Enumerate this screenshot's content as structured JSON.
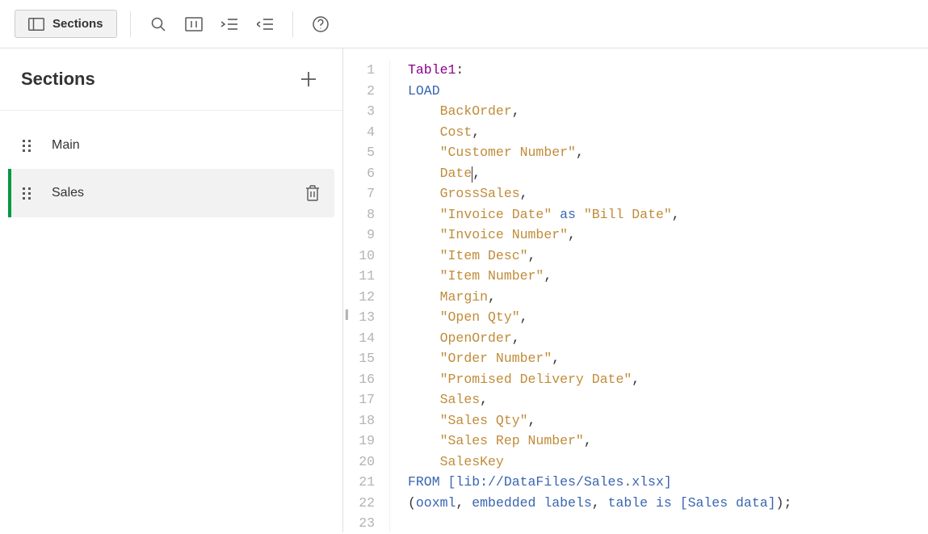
{
  "toolbar": {
    "sections_label": "Sections"
  },
  "sidebar": {
    "title": "Sections",
    "items": [
      {
        "label": "Main",
        "active": false,
        "deletable": false
      },
      {
        "label": "Sales",
        "active": true,
        "deletable": true
      }
    ]
  },
  "editor": {
    "lines": [
      {
        "n": 1,
        "tokens": [
          {
            "t": "Table1",
            "c": "label"
          },
          {
            "t": ":",
            "c": "punct"
          }
        ]
      },
      {
        "n": 2,
        "tokens": [
          {
            "t": "LOAD",
            "c": "kw"
          }
        ]
      },
      {
        "n": 3,
        "tokens": [
          {
            "t": "    ",
            "c": "ws"
          },
          {
            "t": "BackOrder",
            "c": "field"
          },
          {
            "t": ",",
            "c": "punct"
          }
        ]
      },
      {
        "n": 4,
        "tokens": [
          {
            "t": "    ",
            "c": "ws"
          },
          {
            "t": "Cost",
            "c": "field"
          },
          {
            "t": ",",
            "c": "punct"
          }
        ]
      },
      {
        "n": 5,
        "tokens": [
          {
            "t": "    ",
            "c": "ws"
          },
          {
            "t": "\"Customer Number\"",
            "c": "field"
          },
          {
            "t": ",",
            "c": "punct"
          }
        ]
      },
      {
        "n": 6,
        "tokens": [
          {
            "t": "    ",
            "c": "ws"
          },
          {
            "t": "Date",
            "c": "field"
          },
          {
            "t": "|",
            "c": "cursor"
          },
          {
            "t": ",",
            "c": "punct"
          }
        ]
      },
      {
        "n": 7,
        "tokens": [
          {
            "t": "    ",
            "c": "ws"
          },
          {
            "t": "GrossSales",
            "c": "field"
          },
          {
            "t": ",",
            "c": "punct"
          }
        ]
      },
      {
        "n": 8,
        "tokens": [
          {
            "t": "    ",
            "c": "ws"
          },
          {
            "t": "\"Invoice Date\"",
            "c": "field"
          },
          {
            "t": " ",
            "c": "ws"
          },
          {
            "t": "as",
            "c": "kw"
          },
          {
            "t": " ",
            "c": "ws"
          },
          {
            "t": "\"Bill Date\"",
            "c": "field"
          },
          {
            "t": ",",
            "c": "punct"
          }
        ]
      },
      {
        "n": 9,
        "tokens": [
          {
            "t": "    ",
            "c": "ws"
          },
          {
            "t": "\"Invoice Number\"",
            "c": "field"
          },
          {
            "t": ",",
            "c": "punct"
          }
        ]
      },
      {
        "n": 10,
        "tokens": [
          {
            "t": "    ",
            "c": "ws"
          },
          {
            "t": "\"Item Desc\"",
            "c": "field"
          },
          {
            "t": ",",
            "c": "punct"
          }
        ]
      },
      {
        "n": 11,
        "tokens": [
          {
            "t": "    ",
            "c": "ws"
          },
          {
            "t": "\"Item Number\"",
            "c": "field"
          },
          {
            "t": ",",
            "c": "punct"
          }
        ]
      },
      {
        "n": 12,
        "tokens": [
          {
            "t": "    ",
            "c": "ws"
          },
          {
            "t": "Margin",
            "c": "field"
          },
          {
            "t": ",",
            "c": "punct"
          }
        ]
      },
      {
        "n": 13,
        "tokens": [
          {
            "t": "    ",
            "c": "ws"
          },
          {
            "t": "\"Open Qty\"",
            "c": "field"
          },
          {
            "t": ",",
            "c": "punct"
          }
        ]
      },
      {
        "n": 14,
        "tokens": [
          {
            "t": "    ",
            "c": "ws"
          },
          {
            "t": "OpenOrder",
            "c": "field"
          },
          {
            "t": ",",
            "c": "punct"
          }
        ]
      },
      {
        "n": 15,
        "tokens": [
          {
            "t": "    ",
            "c": "ws"
          },
          {
            "t": "\"Order Number\"",
            "c": "field"
          },
          {
            "t": ",",
            "c": "punct"
          }
        ]
      },
      {
        "n": 16,
        "tokens": [
          {
            "t": "    ",
            "c": "ws"
          },
          {
            "t": "\"Promised Delivery Date\"",
            "c": "field"
          },
          {
            "t": ",",
            "c": "punct"
          }
        ]
      },
      {
        "n": 17,
        "tokens": [
          {
            "t": "    ",
            "c": "ws"
          },
          {
            "t": "Sales",
            "c": "field"
          },
          {
            "t": ",",
            "c": "punct"
          }
        ]
      },
      {
        "n": 18,
        "tokens": [
          {
            "t": "    ",
            "c": "ws"
          },
          {
            "t": "\"Sales Qty\"",
            "c": "field"
          },
          {
            "t": ",",
            "c": "punct"
          }
        ]
      },
      {
        "n": 19,
        "tokens": [
          {
            "t": "    ",
            "c": "ws"
          },
          {
            "t": "\"Sales Rep Number\"",
            "c": "field"
          },
          {
            "t": ",",
            "c": "punct"
          }
        ]
      },
      {
        "n": 20,
        "tokens": [
          {
            "t": "    ",
            "c": "ws"
          },
          {
            "t": "SalesKey",
            "c": "field"
          }
        ]
      },
      {
        "n": 21,
        "tokens": [
          {
            "t": "FROM",
            "c": "kw"
          },
          {
            "t": " ",
            "c": "ws"
          },
          {
            "t": "[lib://DataFiles/Sales.xlsx]",
            "c": "kw"
          }
        ]
      },
      {
        "n": 22,
        "tokens": [
          {
            "t": "(",
            "c": "paren"
          },
          {
            "t": "ooxml",
            "c": "kw"
          },
          {
            "t": ", ",
            "c": "punct"
          },
          {
            "t": "embedded labels",
            "c": "kw"
          },
          {
            "t": ", ",
            "c": "punct"
          },
          {
            "t": "table is",
            "c": "kw"
          },
          {
            "t": " ",
            "c": "ws"
          },
          {
            "t": "[Sales data]",
            "c": "kw"
          },
          {
            "t": ")",
            "c": "paren"
          },
          {
            "t": ";",
            "c": "punct"
          }
        ]
      },
      {
        "n": 23,
        "tokens": []
      }
    ]
  }
}
